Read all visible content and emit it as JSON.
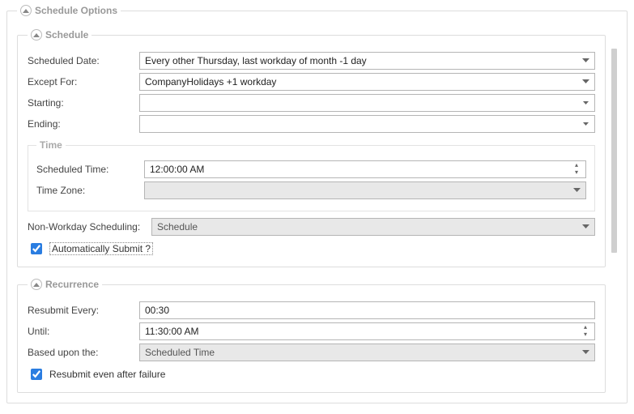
{
  "outer": {
    "title": "Schedule Options"
  },
  "schedule": {
    "title": "Schedule",
    "scheduledDateLabel": "Scheduled Date:",
    "scheduledDateValue": "Every other Thursday, last workday of month -1 day",
    "exceptForLabel": "Except For:",
    "exceptForValue": "CompanyHolidays +1 workday",
    "startingLabel": "Starting:",
    "startingValue": "",
    "endingLabel": "Ending:",
    "endingValue": "",
    "time": {
      "title": "Time",
      "scheduledTimeLabel": "Scheduled Time:",
      "scheduledTimeValue": "12:00:00 AM",
      "timeZoneLabel": "Time Zone:",
      "timeZoneValue": ""
    },
    "nonWorkdayLabel": "Non-Workday Scheduling:",
    "nonWorkdayValue": "Schedule",
    "autoSubmitLabel": "Automatically Submit ?"
  },
  "recurrence": {
    "title": "Recurrence",
    "resubmitEveryLabel": "Resubmit Every:",
    "resubmitEveryValue": "00:30",
    "untilLabel": "Until:",
    "untilValue": "11:30:00 AM",
    "basedUponLabel": "Based upon the:",
    "basedUponValue": "Scheduled Time",
    "resubmitAfterFailureLabel": "Resubmit even after failure"
  }
}
